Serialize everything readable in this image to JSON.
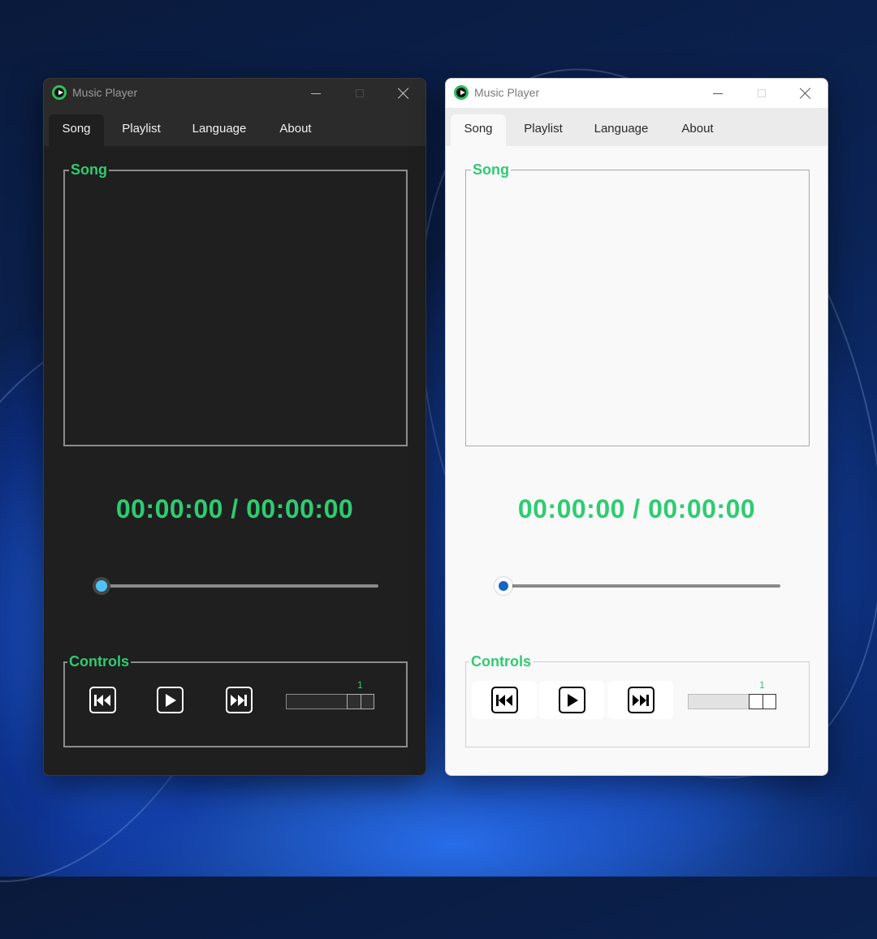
{
  "windows": [
    {
      "theme": "dark",
      "title": "Music Player",
      "tabs": [
        "Song",
        "Playlist",
        "Language",
        "About"
      ],
      "active_tab": "Song",
      "song_group_label": "Song",
      "time_display": "00:00:00 / 00:00:00",
      "progress": 0,
      "controls_group_label": "Controls",
      "volume_value": "1",
      "icons": {
        "app": "music-player-icon",
        "prev": "skip-previous-icon",
        "play": "play-icon",
        "next": "skip-next-icon"
      }
    },
    {
      "theme": "light",
      "title": "Music Player",
      "tabs": [
        "Song",
        "Playlist",
        "Language",
        "About"
      ],
      "active_tab": "Song",
      "song_group_label": "Song",
      "time_display": "00:00:00 / 00:00:00",
      "progress": 0,
      "controls_group_label": "Controls",
      "volume_value": "1",
      "icons": {
        "app": "music-player-icon",
        "prev": "skip-previous-icon",
        "play": "play-icon",
        "next": "skip-next-icon"
      }
    }
  ],
  "colors": {
    "accent_green": "#2ecc71",
    "dark_bg": "#1f1f1f",
    "light_bg": "#f9f9f9",
    "dark_slider_thumb": "#4fc3f7",
    "light_slider_thumb": "#1565c0"
  }
}
